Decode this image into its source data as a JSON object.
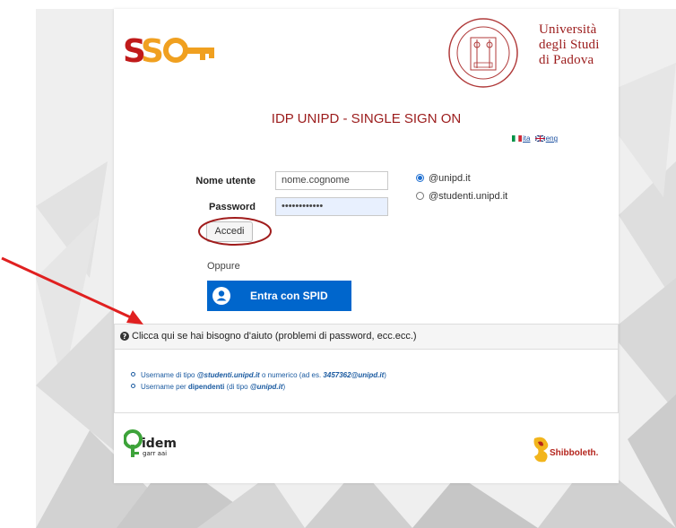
{
  "header": {
    "logo": "SSO",
    "university_lines": [
      "Università",
      "degli Studi",
      "di Padova"
    ]
  },
  "page_title": "IDP UNIPD - SINGLE SIGN ON",
  "languages": [
    {
      "flag": "italy-flag-icon",
      "label": "ita"
    },
    {
      "flag": "uk-flag-icon",
      "label": "eng"
    }
  ],
  "form": {
    "username_label": "Nome utente",
    "username_value": "nome.cognome",
    "password_label": "Password",
    "password_value": "••••••••••••",
    "domains": [
      {
        "label": "@unipd.it",
        "selected": true
      },
      {
        "label": "@studenti.unipd.it",
        "selected": false
      }
    ],
    "submit_label": "Accedi",
    "or_label": "Oppure",
    "spid_label": "Entra con SPID"
  },
  "help": {
    "title": "Clicca qui se hai bisogno d'aiuto (problemi di password, ecc.ecc.)",
    "items": [
      {
        "before": "Username di tipo ",
        "bold": "@studenti.unipd.it",
        "middle": " o numerico (ad es. ",
        "bold2": "3457362@unipd.it",
        "after": ")"
      },
      {
        "before": "Username per ",
        "bold": "dipendenti",
        "middle": " (di tipo ",
        "bold2": "@unipd.it",
        "after": ")"
      }
    ]
  },
  "footer": {
    "idem_text": "idem",
    "garr_text": "garr aai",
    "shibboleth_text": "Shibboleth."
  },
  "colors": {
    "brand_red": "#9b1b1b",
    "spid_blue": "#0066cc",
    "link_blue": "#1a5aa0",
    "annotation_red": "#e02020"
  }
}
